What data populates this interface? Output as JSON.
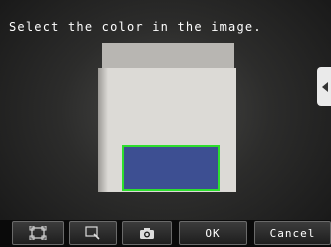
{
  "prompt": "Select the color in the image.",
  "colors": {
    "selection_border": "#2dde2d",
    "selected_color": "#3d4f92"
  },
  "toolbar": {
    "frame_icon": "frame-select-icon",
    "zoom_icon": "zoom-icon",
    "camera_icon": "camera-icon",
    "ok_label": "OK",
    "cancel_label": "Cancel"
  },
  "side_tab_icon": "chevron-left-icon"
}
